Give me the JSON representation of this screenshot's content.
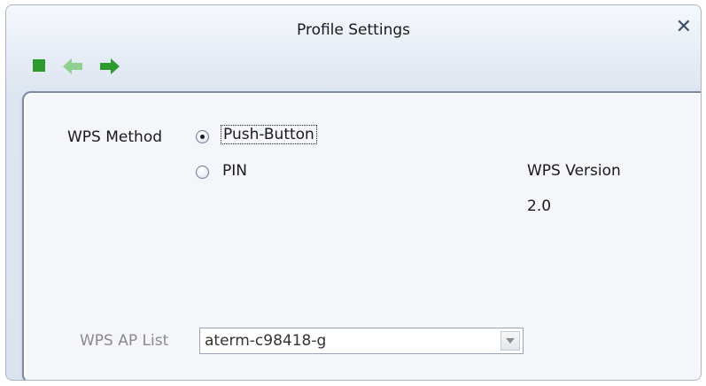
{
  "window": {
    "title": "Profile Settings",
    "close_glyph": "✕"
  },
  "toolbar": {
    "stop_icon": "stop-icon",
    "back_icon": "back-arrow-icon",
    "forward_icon": "forward-arrow-icon",
    "icon_color": "#2e9a2e"
  },
  "wps": {
    "method_label": "WPS Method",
    "options": [
      {
        "label": "Push-Button",
        "selected": true
      },
      {
        "label": "PIN",
        "selected": false
      }
    ],
    "version_label": "WPS Version",
    "version_value": "2.0",
    "ap_list_label": "WPS AP List",
    "ap_list_value": "aterm-c98418-g"
  }
}
